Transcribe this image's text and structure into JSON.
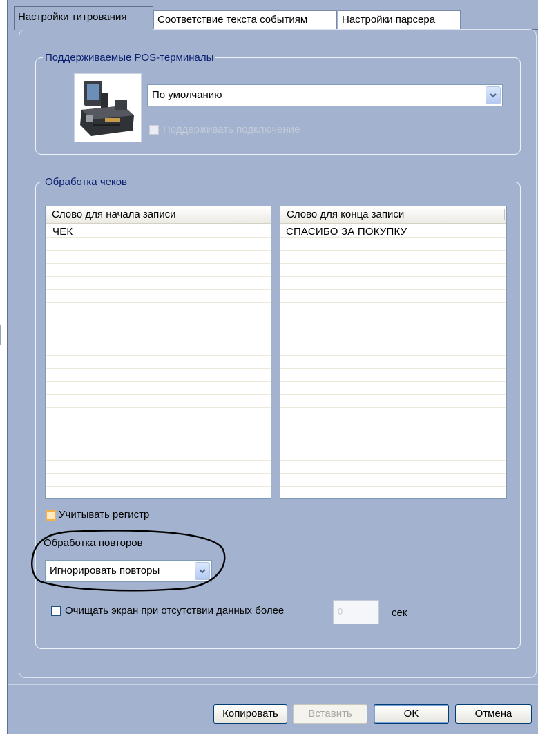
{
  "tabs": [
    {
      "label": "Настройки титрования",
      "active": true
    },
    {
      "label": "Соответствие текста событиям",
      "active": false
    },
    {
      "label": "Настройки парсера",
      "active": false
    }
  ],
  "pos_group": {
    "legend": "Поддерживаемые POS-терминалы",
    "terminal_select": "По умолчанию",
    "support_connection_label": "Поддерживать подключение",
    "support_connection_checked": false,
    "support_connection_enabled": false,
    "terminal_icon": "pos-terminal-icon"
  },
  "receipt_group": {
    "legend": "Обработка чеков",
    "start_list": {
      "header": "Слово для начала записи",
      "rows": [
        "ЧЕК"
      ]
    },
    "end_list": {
      "header": "Слово для конца записи",
      "rows": [
        "СПАСИБО ЗА ПОКУПКУ"
      ]
    },
    "case_sensitive_label": "Учитывать регистр",
    "repeat_label": "Обработка повторов",
    "repeat_select": "Игнорировать повторы",
    "clear_screen_label": "Очищать экран при отсутствии данных более",
    "clear_screen_value": "0",
    "seconds_label": "сек"
  },
  "buttons": {
    "copy": "Копировать",
    "paste": "Вставить",
    "ok": "OK",
    "cancel": "Отмена"
  },
  "colors": {
    "window_bg": "#a3b3cf",
    "legend_text": "#0b1f70",
    "highlight_ellipse": "#000000"
  }
}
